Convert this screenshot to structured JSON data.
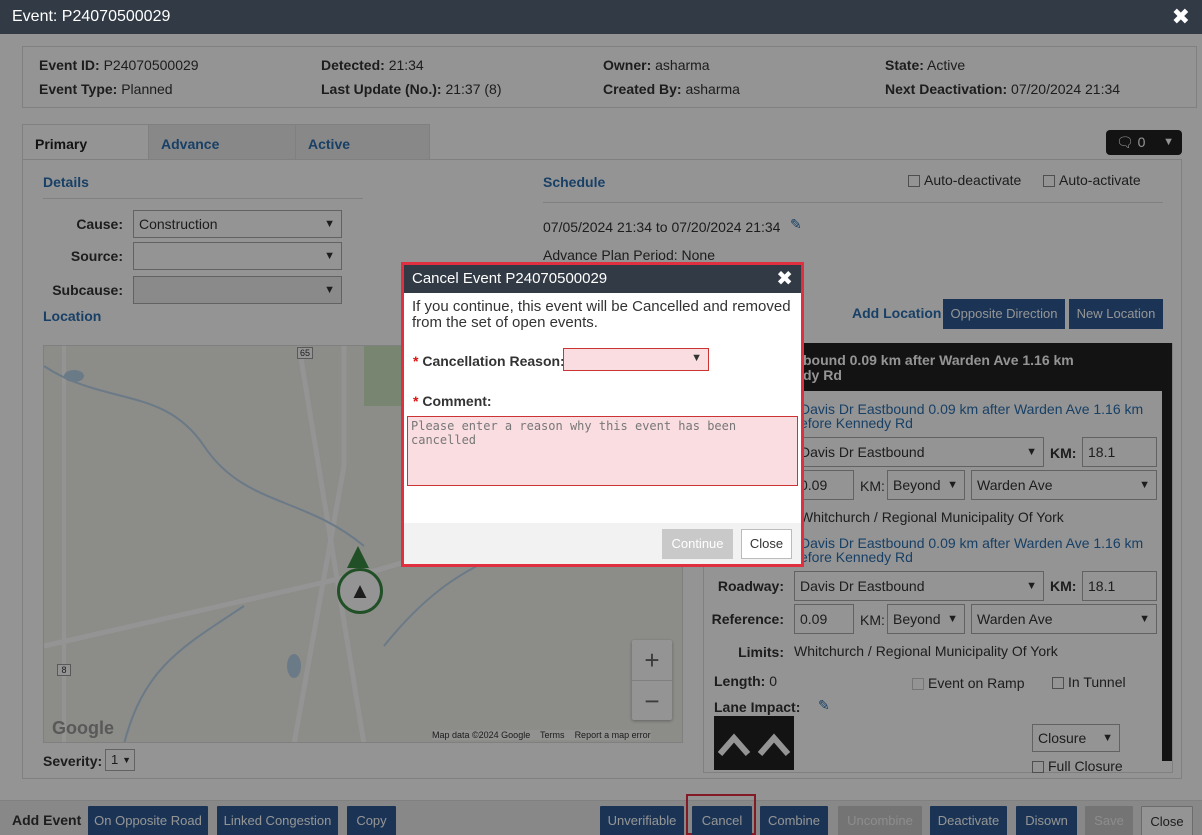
{
  "window": {
    "title": "Event: P24070500029",
    "close_glyph": "✖"
  },
  "info": {
    "event_id_label": "Event ID:",
    "event_id": "P24070500029",
    "event_type_label": "Event Type:",
    "event_type": "Planned",
    "detected_label": "Detected:",
    "detected": "21:34",
    "last_update_label": "Last Update (No.):",
    "last_update": "21:37 (8)",
    "owner_label": "Owner:",
    "owner": "asharma",
    "created_by_label": "Created By:",
    "created_by": "asharma",
    "state_label": "State:",
    "state": "Active",
    "next_deact_label": "Next Deactivation:",
    "next_deact": "07/20/2024 21:34"
  },
  "tabs": [
    "Primary Details",
    "Advance Response",
    "Active Response"
  ],
  "comments": {
    "count": "0"
  },
  "details": {
    "title": "Details",
    "cause_label": "Cause:",
    "cause": "Construction",
    "source_label": "Source:",
    "source": "",
    "subcause_label": "Subcause:",
    "subcause": ""
  },
  "schedule": {
    "title": "Schedule",
    "auto_deactivate": "Auto-deactivate",
    "auto_activate": "Auto-activate",
    "range": "07/05/2024 21:34 to 07/20/2024 21:34",
    "advance_plan": "Advance Plan Period: None"
  },
  "location": {
    "title": "Location",
    "add_location": "Add Location",
    "opposite_direction": "Opposite Direction",
    "new_location": "New Location",
    "header_line1": "bound 0.09 km after Warden Ave 1.16 km",
    "header_line2": "dy Rd",
    "link1_line1": "Davis Dr Eastbound 0.09 km after Warden Ave 1.16 km",
    "link1_line2": "efore Kennedy Rd",
    "roadway_partial": "Davis Dr Eastbound",
    "km_label": "KM:",
    "km_value": "18.1",
    "ref_partial": "0.09",
    "beyond": "Beyond",
    "warden": "Warden Ave",
    "limits_partial": "Whitchurch / Regional Municipality Of York",
    "link2_line1": "Davis Dr Eastbound 0.09 km after Warden Ave 1.16 km",
    "link2_line2": "efore Kennedy Rd",
    "roadway_label": "Roadway:",
    "roadway": "Davis Dr Eastbound",
    "reference_label": "Reference:",
    "reference": "0.09",
    "limits_label": "Limits:",
    "limits": "Whitchurch / Regional Municipality Of York",
    "length_label": "Length:",
    "length": "0",
    "event_on_ramp": "Event on Ramp",
    "in_tunnel": "In Tunnel",
    "lane_impact_label": "Lane Impact:",
    "closure": "Closure",
    "full_closure": "Full Closure"
  },
  "map": {
    "google": "Google",
    "attribution": "Map data ©2024 Google",
    "terms": "Terms",
    "report": "Report a map error",
    "road_65": "65",
    "road_8": "8",
    "zoom_in": "+",
    "zoom_out": "−"
  },
  "severity": {
    "label": "Severity:",
    "value": "1"
  },
  "footer": {
    "add_event": "Add Event",
    "on_opposite_road": "On Opposite Road",
    "linked_congestion": "Linked Congestion",
    "copy": "Copy",
    "unverifiable": "Unverifiable",
    "cancel": "Cancel",
    "combine": "Combine",
    "uncombine": "Uncombine",
    "deactivate": "Deactivate",
    "disown": "Disown",
    "save": "Save",
    "close": "Close"
  },
  "modal": {
    "title": "Cancel Event P24070500029",
    "close_glyph": "✖",
    "message": "If you continue, this event will be Cancelled and removed from the set of open events.",
    "reason_label": "Cancellation Reason:",
    "comment_label": "Comment:",
    "comment_placeholder": "Please enter a reason why this event has been cancelled",
    "continue": "Continue",
    "close": "Close"
  },
  "colors": {
    "header_bg": "#323a45",
    "primary_btn": "#2f5b93",
    "link": "#2a6fb0",
    "highlight_red": "#e03040"
  }
}
